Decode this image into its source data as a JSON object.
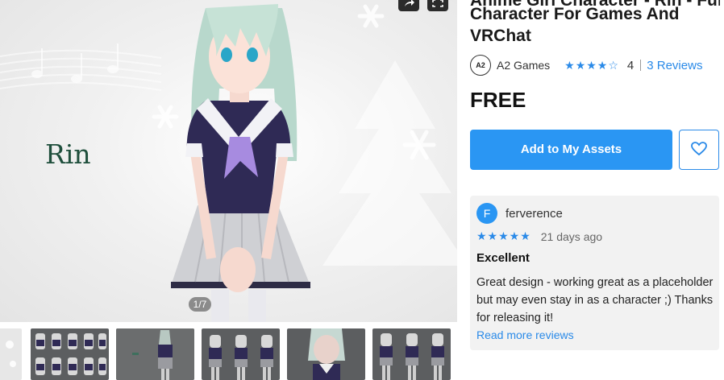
{
  "gallery": {
    "hero_label": "Rin",
    "counter": "1/7",
    "thumbnails": [
      {
        "name": "thumb-partial"
      },
      {
        "name": "thumb-2"
      },
      {
        "name": "thumb-3"
      },
      {
        "name": "thumb-4"
      },
      {
        "name": "thumb-5"
      },
      {
        "name": "thumb-6"
      }
    ]
  },
  "product": {
    "title_cut": "Anime Girl Character - Rin - Fully Rigged",
    "title": "Character For Games And VRChat",
    "publisher_logo": "A2",
    "publisher": "A2 Games",
    "stars_filled": "★★★★",
    "stars_empty": "☆",
    "rating": "4",
    "reviews_link": "3 Reviews",
    "price": "FREE",
    "add_button": "Add to My Assets"
  },
  "review": {
    "avatar_letter": "F",
    "author": "ferverence",
    "stars": "★★★★★",
    "date": "21 days ago",
    "title": "Excellent",
    "body": "Great design - working great as a placeholder but may even stay in as a character ;) Thanks for releasing it!",
    "read_more": "Read more reviews"
  },
  "colors": {
    "accent": "#2a96f3",
    "link": "#2a8ae8",
    "card": "#f2f2f2"
  },
  "icons": [
    "share-icon",
    "expand-icon",
    "heart-icon",
    "star-icon"
  ]
}
